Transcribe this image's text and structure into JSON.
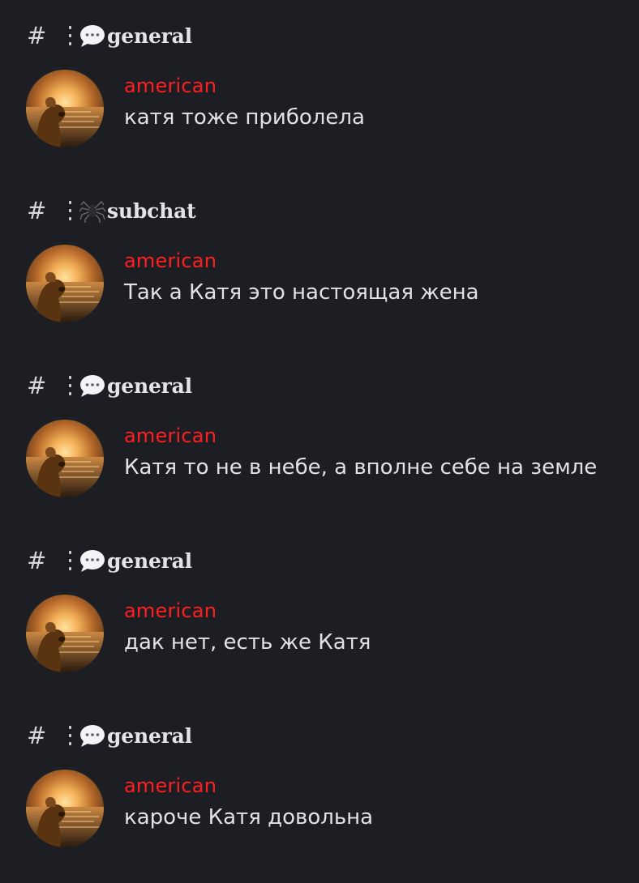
{
  "results": [
    {
      "channel_icon": "speech-bubble-icon",
      "channel": "general",
      "author": "american",
      "message": "катя тоже приболела"
    },
    {
      "channel_icon": "spider-icon",
      "channel": "subchat",
      "author": "american",
      "message": "Так а Катя это настоящая жена"
    },
    {
      "channel_icon": "speech-bubble-icon",
      "channel": "general",
      "author": "american",
      "message": "Катя то не в небе, а вполне себе на земле"
    },
    {
      "channel_icon": "speech-bubble-icon",
      "channel": "general",
      "author": "american",
      "message": "дак нет, есть же Катя"
    },
    {
      "channel_icon": "speech-bubble-icon",
      "channel": "general",
      "author": "american",
      "message": "кароче Катя довольна"
    }
  ],
  "colors": {
    "background": "#1d1e23",
    "username": "#ff1f1f",
    "text": "#e1e2e6"
  }
}
